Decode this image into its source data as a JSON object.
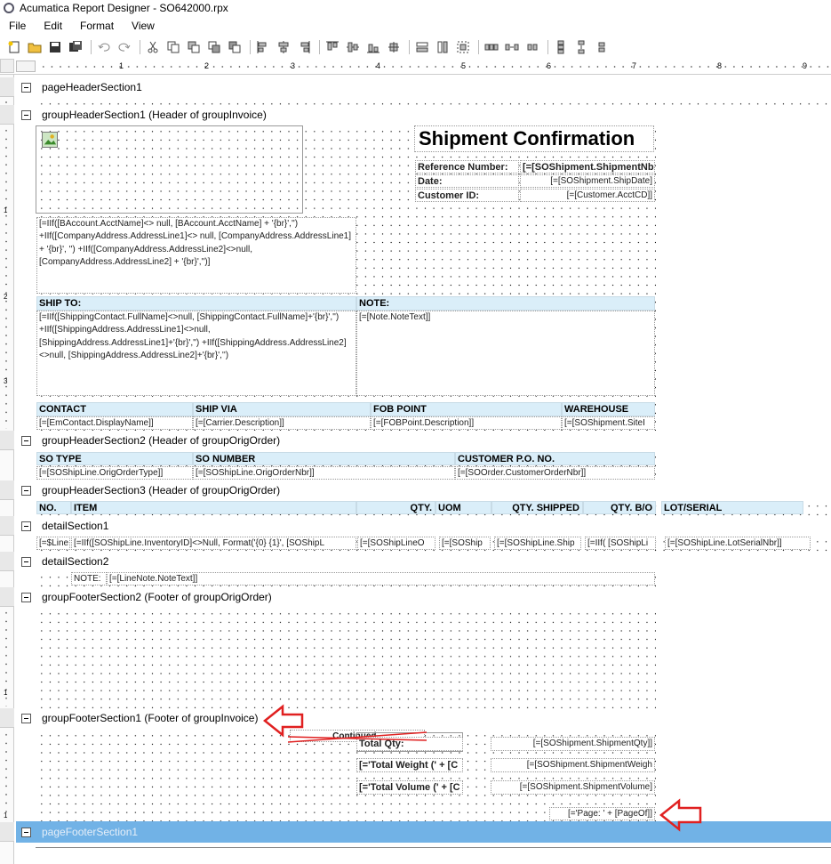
{
  "window": {
    "title": "Acumatica Report Designer - SO642000.rpx"
  },
  "menu": [
    "File",
    "Edit",
    "Format",
    "View"
  ],
  "ruler": {
    "marks": [
      "1",
      "2",
      "3",
      "4",
      "5",
      "6",
      "7",
      "8",
      "9"
    ]
  },
  "left_ruler": {
    "marks": [
      "1",
      "2",
      "3",
      "1",
      "1"
    ]
  },
  "sections": {
    "pageHeader": "pageHeaderSection1",
    "groupHeader1": "groupHeaderSection1 (Header of groupInvoice)",
    "groupHeader2": "groupHeaderSection2 (Header of groupOrigOrder)",
    "groupHeader3": "groupHeaderSection3 (Header of groupOrigOrder)",
    "detail1": "detailSection1",
    "detail2": "detailSection2",
    "groupFooter2": "groupFooterSection2 (Footer of groupOrigOrder)",
    "groupFooter1": "groupFooterSection1 (Footer of groupInvoice)",
    "pageFooter": "pageFooterSection1"
  },
  "header1": {
    "title": "Shipment Confirmation",
    "ref_label": "Reference Number:",
    "ref_value": "[=[SOShipment.ShipmentNbr",
    "date_label": "Date:",
    "date_value": "[=[SOShipment.ShipDate]",
    "cust_label": "Customer ID:",
    "cust_value": "[=[Customer.AcctCD]]",
    "company_address": "[=IIf([BAccount.AcctName]<> null, [BAccount.AcctName] + '{br}','') +IIf([CompanyAddress.AddressLine1]<> null, [CompanyAddress.AddressLine1] + '{br}', '') +IIf([CompanyAddress.AddressLine2]<>null, [CompanyAddress.AddressLine2] + '{br}','')]",
    "ship_to_label": "SHIP TO:",
    "note_label": "NOTE:",
    "ship_to_value": "[=IIf([ShippingContact.FullName]<>null, [ShippingContact.FullName]+'{br}','') +IIf([ShippingAddress.AddressLine1]<>null, [ShippingAddress.AddressLine1]+'{br}','') +IIf([ShippingAddress.AddressLine2]<>null, [ShippingAddress.AddressLine2]+'{br}','')",
    "note_value": "[=[Note.NoteText]]",
    "contact_label": "CONTACT",
    "shipvia_label": "SHIP VIA",
    "fob_label": "FOB POINT",
    "warehouse_label": "WAREHOUSE",
    "contact_value": "[=[EmContact.DisplayName]]",
    "shipvia_value": "[=[Carrier.Description]]",
    "fob_value": "[=[FOBPoint.Description]]",
    "warehouse_value": "[=[SOShipment.SiteI"
  },
  "header2": {
    "sotype_label": "SO TYPE",
    "sonumber_label": "SO NUMBER",
    "custpo_label": "CUSTOMER P.O. NO.",
    "sotype_value": "[=[SOShipLine.OrigOrderType]]",
    "sonumber_value": "[=[SOShipLine.OrigOrderNbr]]",
    "custpo_value": "[=[SOOrder.CustomerOrderNbr]]"
  },
  "header3": {
    "columns": [
      "NO.",
      "ITEM",
      "QTY.",
      "UOM",
      "QTY. SHIPPED",
      "QTY. B/O",
      "LOT/SERIAL"
    ]
  },
  "detail1": {
    "cells": [
      "[=$Line",
      "[=IIf([SOShipLine.InventoryID]<>Null, Format('{0} {1}', [SOShipL",
      "[=[SOShipLineO",
      "[=[SOShip",
      "[=[SOShipLine.Ship",
      "[=IIf( [SOShipLi",
      "[=[SOShipLine.LotSerialNbr]]"
    ]
  },
  "detail2": {
    "note_label": "NOTE:",
    "note_value": "[=[LineNote.NoteText]]"
  },
  "footer1": {
    "continued": "Continued...",
    "total_qty": "Total Qty:",
    "total_qty_value": "[=[SOShipment.ShipmentQty]]",
    "total_weight": "[='Total Weight (' + [C",
    "total_weight_value": "[=[SOShipment.ShipmentWeigh",
    "total_volume": "[='Total Volume (' + [C",
    "total_volume_value": "[=[SOShipment.ShipmentVolume]",
    "page": "[='Page: ' + [PageOf]]"
  },
  "colors": {
    "header_fill": "#daeef9",
    "selected_section": "#71b2e6",
    "annotation_arrow": "#e02020"
  }
}
